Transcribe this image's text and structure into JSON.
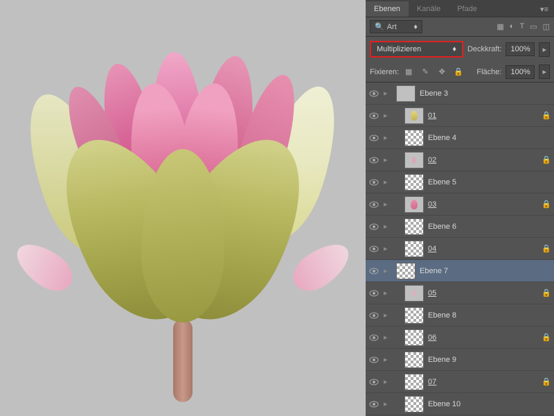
{
  "tabs": {
    "layers": "Ebenen",
    "channels": "Kanäle",
    "paths": "Pfade"
  },
  "search": {
    "label": "Art"
  },
  "blend": {
    "mode": "Multiplizieren",
    "opacity_label": "Deckkraft:",
    "opacity": "100%",
    "fill_label": "Fläche:",
    "fill": "100%",
    "lock_label": "Fixieren:"
  },
  "layers": [
    {
      "name": "Ebene 3",
      "link": false,
      "locked": false,
      "selected": false,
      "indent": false,
      "thumb": "gray"
    },
    {
      "name": "01",
      "link": true,
      "locked": true,
      "selected": false,
      "indent": true,
      "thumb": "petal-yellow"
    },
    {
      "name": "Ebene 4",
      "link": false,
      "locked": false,
      "selected": false,
      "indent": true,
      "thumb": "checker"
    },
    {
      "name": "02",
      "link": true,
      "locked": true,
      "selected": false,
      "indent": true,
      "thumb": "petal-small"
    },
    {
      "name": "Ebene 5",
      "link": false,
      "locked": false,
      "selected": false,
      "indent": true,
      "thumb": "checker"
    },
    {
      "name": "03",
      "link": true,
      "locked": true,
      "selected": false,
      "indent": true,
      "thumb": "petal-pink"
    },
    {
      "name": "Ebene 6",
      "link": false,
      "locked": false,
      "selected": false,
      "indent": true,
      "thumb": "checker"
    },
    {
      "name": "04",
      "link": true,
      "locked": true,
      "selected": false,
      "indent": true,
      "thumb": "checker"
    },
    {
      "name": "Ebene 7",
      "link": false,
      "locked": false,
      "selected": true,
      "indent": false,
      "thumb": "checker"
    },
    {
      "name": "05",
      "link": true,
      "locked": true,
      "selected": false,
      "indent": true,
      "thumb": "petal-tiny"
    },
    {
      "name": "Ebene 8",
      "link": false,
      "locked": false,
      "selected": false,
      "indent": true,
      "thumb": "checker"
    },
    {
      "name": "06",
      "link": true,
      "locked": true,
      "selected": false,
      "indent": true,
      "thumb": "checker"
    },
    {
      "name": "Ebene 9",
      "link": false,
      "locked": false,
      "selected": false,
      "indent": true,
      "thumb": "checker"
    },
    {
      "name": "07",
      "link": true,
      "locked": true,
      "selected": false,
      "indent": true,
      "thumb": "checker"
    },
    {
      "name": "Ebene 10",
      "link": false,
      "locked": false,
      "selected": false,
      "indent": true,
      "thumb": "checker"
    }
  ]
}
